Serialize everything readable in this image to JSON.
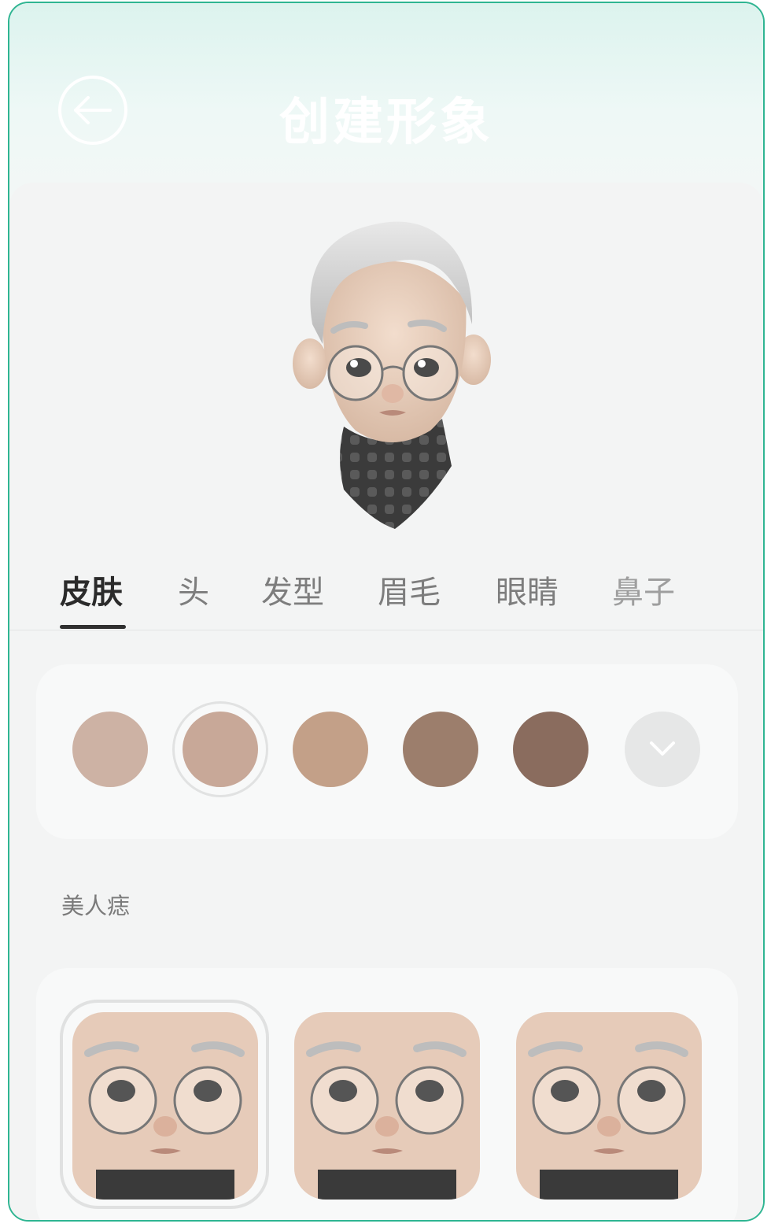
{
  "header": {
    "title": "创建形象"
  },
  "tabs": [
    {
      "label": "皮肤",
      "active": true
    },
    {
      "label": "头"
    },
    {
      "label": "发型"
    },
    {
      "label": "眉毛"
    },
    {
      "label": "眼睛"
    },
    {
      "label": "鼻子"
    }
  ],
  "skin_tones": [
    {
      "color": "#cdb2a4"
    },
    {
      "color": "#c8a898",
      "selected": true
    },
    {
      "color": "#c3a088"
    },
    {
      "color": "#9c7e6c"
    },
    {
      "color": "#8a6c5e"
    }
  ],
  "more_icon": "chevron-down-icon",
  "mole_section": {
    "label": "美人痣",
    "options": [
      {
        "name": "none",
        "selected": true
      },
      {
        "name": "style-1"
      },
      {
        "name": "style-2"
      }
    ]
  },
  "colors": {
    "accent": "#2fb592",
    "active_tab": "#2b2b2b",
    "inactive_tab": "#7d7d7d"
  }
}
